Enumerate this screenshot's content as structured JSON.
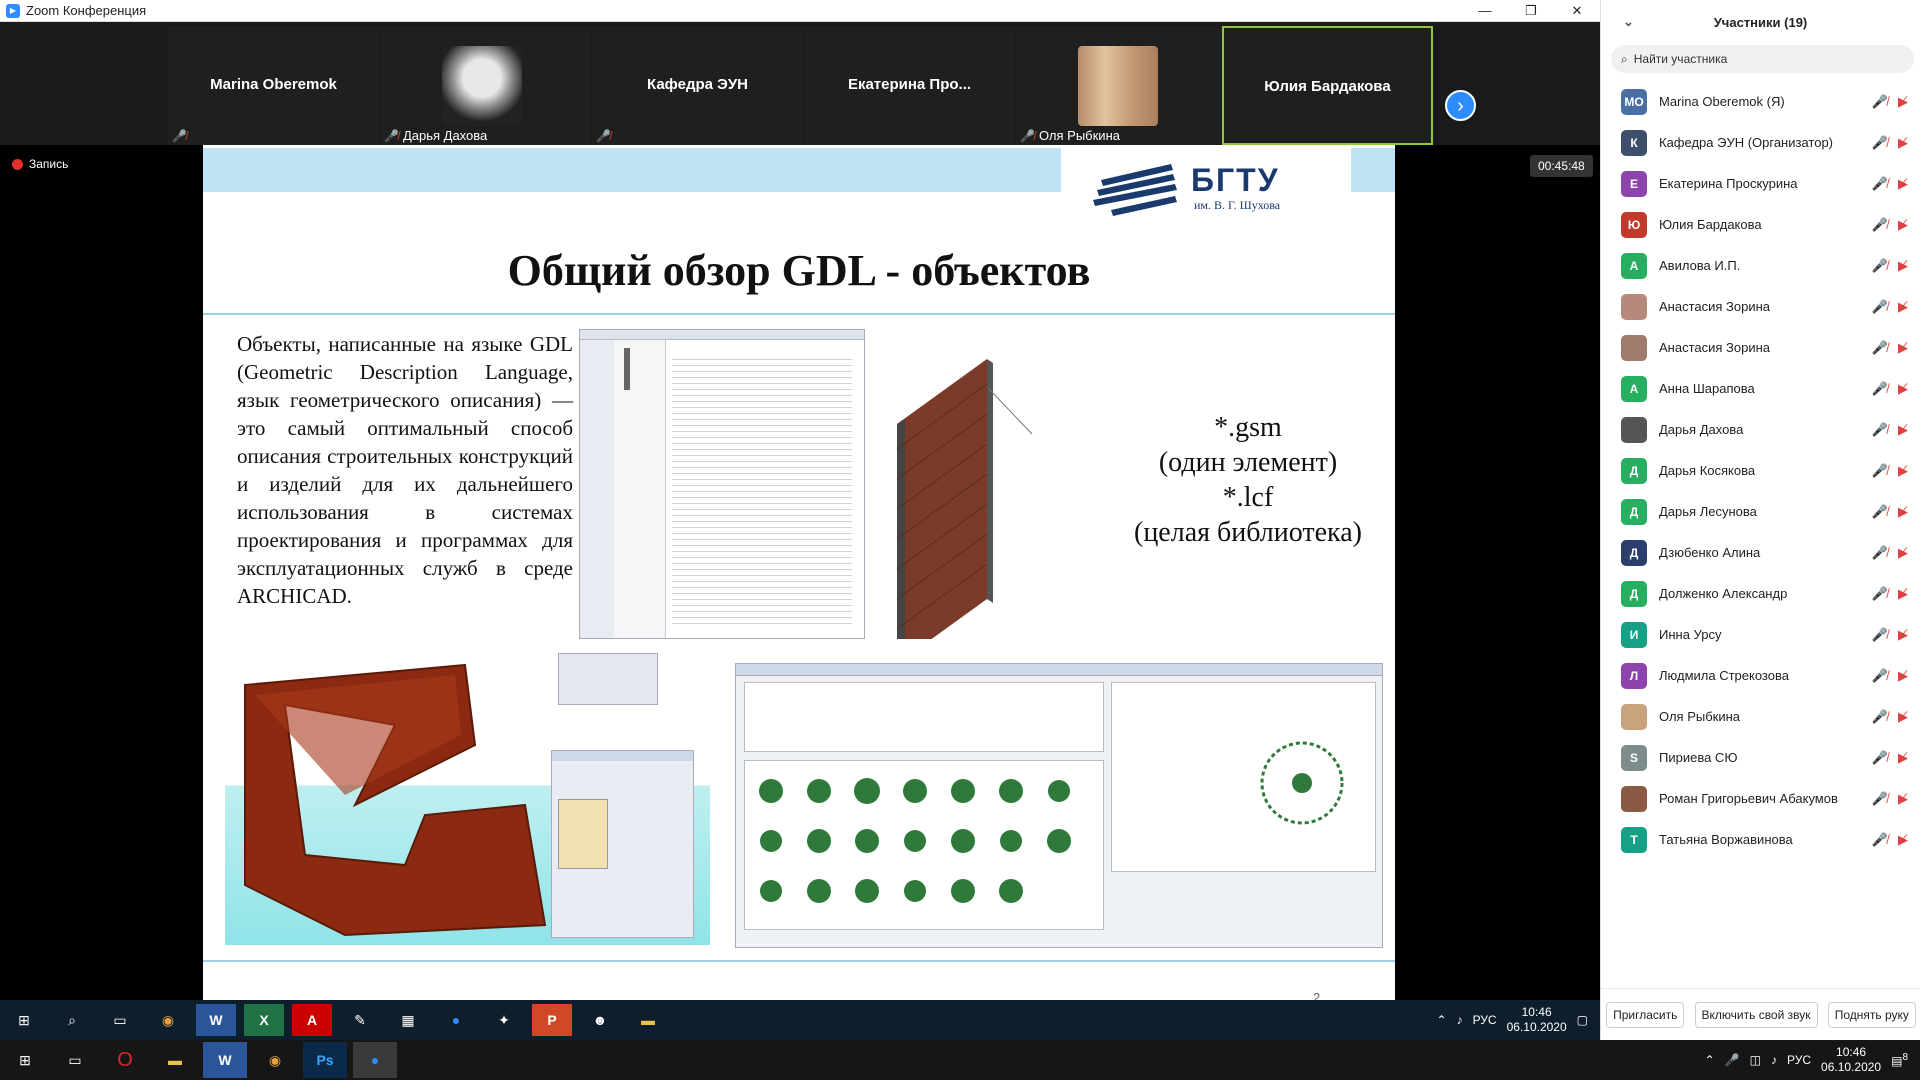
{
  "window": {
    "title": "Zoom Конференция",
    "controls": [
      "—",
      "❐",
      "✕"
    ]
  },
  "gallery": {
    "tiles": [
      {
        "name": "Marina Oberemok",
        "label": ""
      },
      {
        "name": "",
        "label": "Дарья Дахова"
      },
      {
        "name": "Кафедра ЭУН",
        "label": ""
      },
      {
        "name": "Екатерина  Про...",
        "label": ""
      },
      {
        "name": "",
        "label": "Оля Рыбкина"
      },
      {
        "name": "Юлия Бардакова",
        "label": ""
      }
    ],
    "next": "›"
  },
  "recording": {
    "label": "Запись",
    "timer": "00:45:48"
  },
  "slide": {
    "logo_text": "БГТУ",
    "logo_sub": "им. В. Г. Шухова",
    "title": "Общий обзор GDL - объектов",
    "body": "Объекты, написанные на языке GDL (Geometric Description Language, язык геометрического описания) — это самый оптимальный способ описания строительных конструкций и изделий для их дальнейшего использования в системах проектирования и программах для эксплуатационных служб в среде ARCHICAD.",
    "ext_lines": [
      "*.gsm",
      "(один элемент)",
      "*.lcf",
      "(целая библиотека)"
    ],
    "page_number": "2"
  },
  "panel": {
    "title": "Участники (19)",
    "search_placeholder": "Найти участника",
    "participants": [
      {
        "initials": "МО",
        "name": "Marina Oberemok (Я)",
        "color": "#4a6fa5"
      },
      {
        "initials": "К",
        "name": "Кафедра ЭУН (Организатор)",
        "color": "#3d4f6b"
      },
      {
        "initials": "Е",
        "name": "Екатерина Проскурина",
        "color": "#8e44ad"
      },
      {
        "initials": "Ю",
        "name": "Юлия Бардакова",
        "color": "#c0392b"
      },
      {
        "initials": "А",
        "name": "Авилова И.П.",
        "color": "#27ae60"
      },
      {
        "initials": "",
        "name": "Анастасия Зорина",
        "color": "#b58a7a"
      },
      {
        "initials": "",
        "name": "Анастасия Зорина",
        "color": "#a07a6a"
      },
      {
        "initials": "А",
        "name": "Анна Шарапова",
        "color": "#27ae60"
      },
      {
        "initials": "",
        "name": "Дарья Дахова",
        "color": "#555"
      },
      {
        "initials": "Д",
        "name": "Дарья Косякова",
        "color": "#27ae60"
      },
      {
        "initials": "Д",
        "name": "Дарья Лесунова",
        "color": "#27ae60"
      },
      {
        "initials": "Д",
        "name": "Дзюбенко Алина",
        "color": "#2c3e6b"
      },
      {
        "initials": "Д",
        "name": "Долженко Александр",
        "color": "#27ae60"
      },
      {
        "initials": "И",
        "name": "Инна Урсу",
        "color": "#16a085"
      },
      {
        "initials": "Л",
        "name": "Людмила Стрекозова",
        "color": "#8e44ad"
      },
      {
        "initials": "",
        "name": "Оля Рыбкина",
        "color": "#c9a27e"
      },
      {
        "initials": "S",
        "name": "Пириева СЮ",
        "color": "#7f8c8d"
      },
      {
        "initials": "",
        "name": "Роман Григорьевич Абакумов",
        "color": "#8a5a44"
      },
      {
        "initials": "Т",
        "name": "Татьяна Воржавинова",
        "color": "#16a085"
      }
    ],
    "footer": {
      "invite": "Пригласить",
      "unmute": "Включить свой звук",
      "raise": "Поднять руку"
    }
  },
  "taskbar_inner": {
    "lang": "РУС",
    "time": "10:46",
    "date": "06.10.2020"
  },
  "taskbar_outer": {
    "lang": "РУС",
    "time": "10:46",
    "date": "06.10.2020",
    "badge": "8"
  }
}
